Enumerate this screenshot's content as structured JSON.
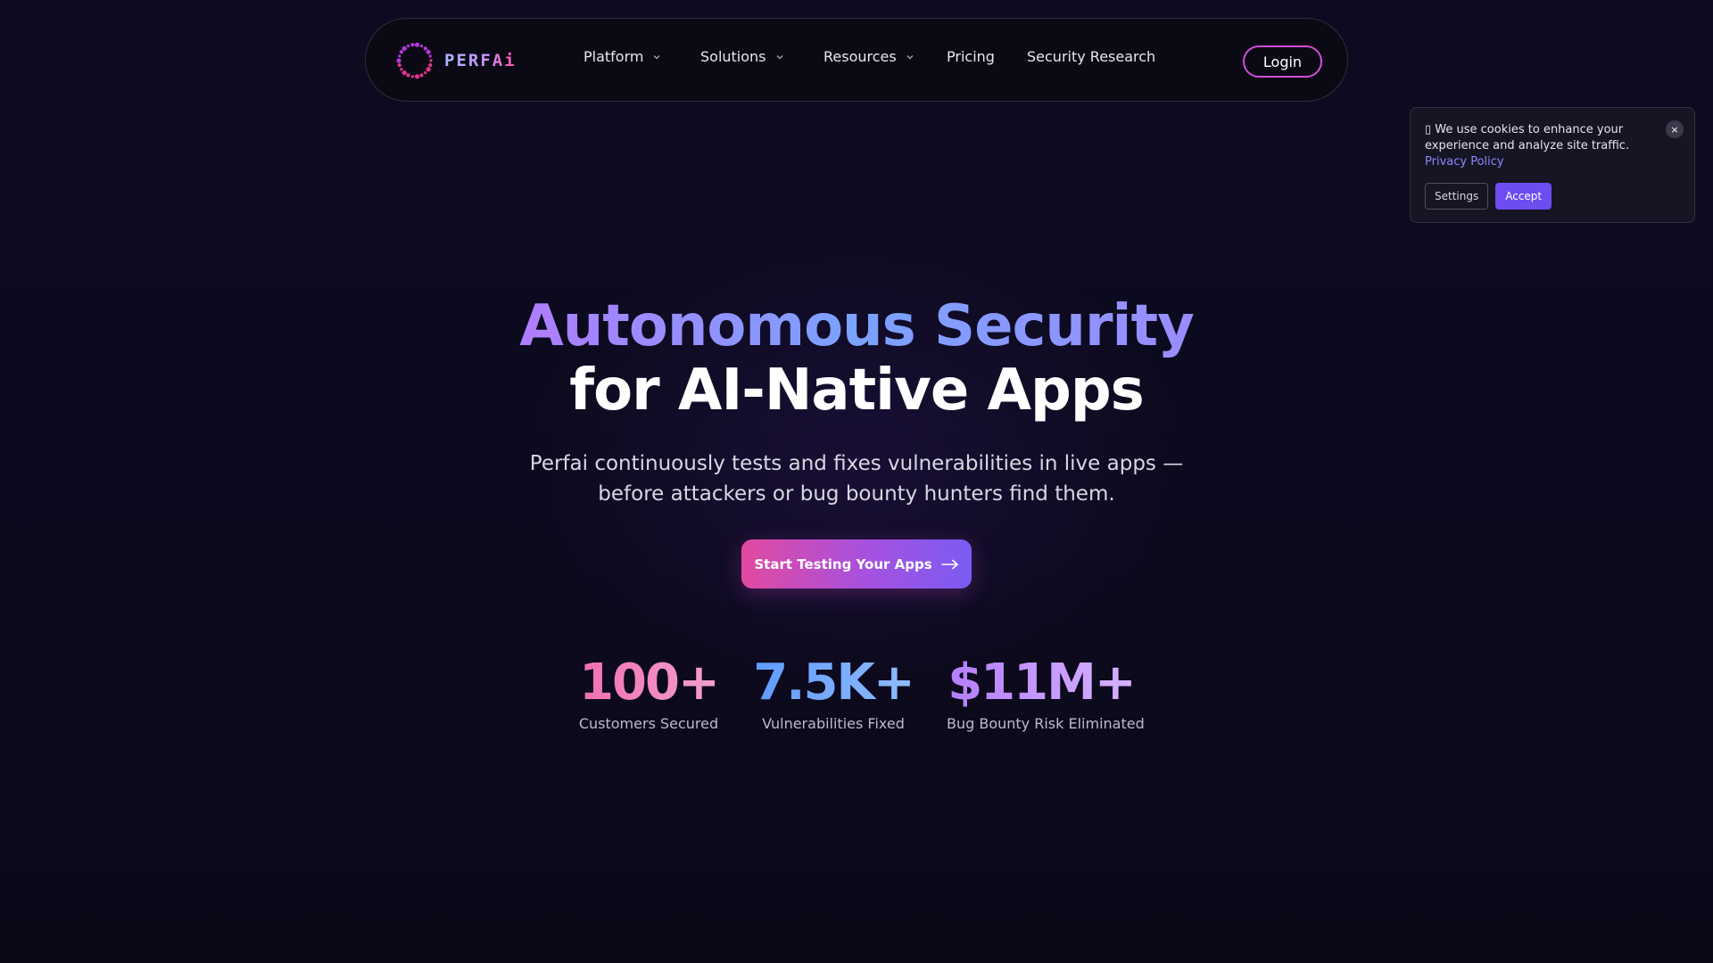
{
  "nav": {
    "logo_text": "PERFAi",
    "items": [
      {
        "label": "Platform",
        "has_dropdown": true
      },
      {
        "label": "Solutions",
        "has_dropdown": true
      },
      {
        "label": "Resources",
        "has_dropdown": true
      },
      {
        "label": "Pricing",
        "has_dropdown": false
      },
      {
        "label": "Security Research",
        "has_dropdown": false
      }
    ],
    "login_label": "Login"
  },
  "cookie": {
    "text": "We use cookies to enhance your experience and analyze site traffic.",
    "link_label": "Privacy Policy",
    "close_label": "×",
    "settings_label": "Settings",
    "accept_label": "Accept"
  },
  "hero": {
    "title_line1": "Autonomous Security",
    "title_line2": "for AI-Native Apps",
    "subtitle": "Perfai continuously tests and fixes vulnerabilities in live apps — before attackers or bug bounty hunters find them.",
    "cta_label": "Start Testing Your Apps"
  },
  "stats": [
    {
      "value": "100+",
      "label": "Customers Secured"
    },
    {
      "value": "7.5K+",
      "label": "Vulnerabilities Fixed"
    },
    {
      "value": "$11M+",
      "label": "Bug Bounty Risk Eliminated"
    }
  ],
  "colors": {
    "background": "#0c0a1d",
    "accent_pink": "#e24aa0",
    "accent_purple": "#7a5cf2",
    "accept_button": "#6d4cf0",
    "link": "#8f86ff"
  },
  "icons": {
    "logo": "dotted-ring-logo",
    "dropdown": "chevron-down-icon",
    "cta": "arrow-right-icon",
    "cookie_close": "close-icon",
    "cookie_prefix": "cookie-icon"
  }
}
